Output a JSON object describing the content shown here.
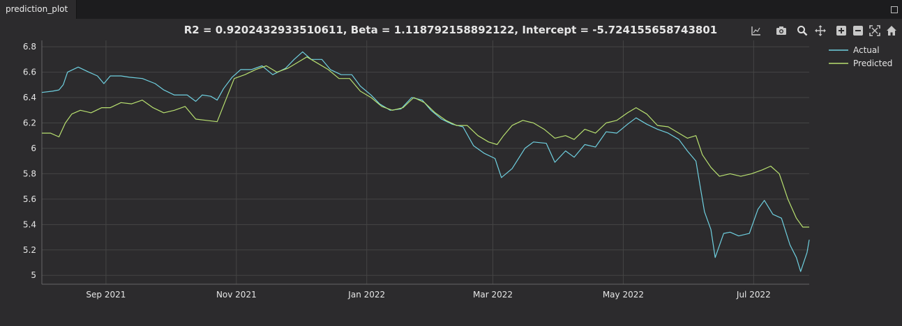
{
  "window": {
    "tab_label": "prediction_plot"
  },
  "toolbar": {
    "tools": [
      {
        "icon": "autoscale-icon"
      },
      {
        "icon": "camera-icon"
      },
      {
        "icon": "zoom-icon"
      },
      {
        "icon": "pan-icon"
      },
      {
        "icon": "zoom-in-icon"
      },
      {
        "icon": "zoom-out-icon"
      },
      {
        "icon": "reset-axes-icon"
      },
      {
        "icon": "home-icon"
      }
    ]
  },
  "colors": {
    "background": "#2c2b2d",
    "grid": "#454545",
    "actual": "#6fd0e0",
    "predicted": "#b8e070",
    "text": "#e6e6e6"
  },
  "chart_data": {
    "type": "line",
    "title": "R2 = 0.9202432933510611, Beta = 1.118792158892122, Intercept = -5.724155658743801",
    "xlabel": "",
    "ylabel": "",
    "xlim": [
      "2021-08-02",
      "2022-07-27"
    ],
    "ylim": [
      4.93,
      6.85
    ],
    "grid": true,
    "legend_position": "top-right",
    "x_ticks": [
      {
        "date": "2021-09-01",
        "label": "Sep 2021"
      },
      {
        "date": "2021-11-01",
        "label": "Nov 2021"
      },
      {
        "date": "2022-01-01",
        "label": "Jan 2022"
      },
      {
        "date": "2022-03-01",
        "label": "Mar 2022"
      },
      {
        "date": "2022-05-01",
        "label": "May 2022"
      },
      {
        "date": "2022-07-01",
        "label": "Jul 2022"
      }
    ],
    "y_ticks": [
      5,
      5.2,
      5.4,
      5.6,
      5.8,
      6,
      6.2,
      6.4,
      6.6,
      6.8
    ],
    "series": [
      {
        "name": "Actual",
        "points": [
          [
            "2021-08-02",
            6.44
          ],
          [
            "2021-08-07",
            6.45
          ],
          [
            "2021-08-10",
            6.46
          ],
          [
            "2021-08-12",
            6.5
          ],
          [
            "2021-08-14",
            6.6
          ],
          [
            "2021-08-19",
            6.64
          ],
          [
            "2021-08-24",
            6.6
          ],
          [
            "2021-08-28",
            6.57
          ],
          [
            "2021-08-31",
            6.51
          ],
          [
            "2021-09-03",
            6.57
          ],
          [
            "2021-09-08",
            6.57
          ],
          [
            "2021-09-12",
            6.56
          ],
          [
            "2021-09-18",
            6.55
          ],
          [
            "2021-09-24",
            6.51
          ],
          [
            "2021-09-28",
            6.46
          ],
          [
            "2021-10-03",
            6.42
          ],
          [
            "2021-10-09",
            6.42
          ],
          [
            "2021-10-13",
            6.37
          ],
          [
            "2021-10-16",
            6.42
          ],
          [
            "2021-10-20",
            6.41
          ],
          [
            "2021-10-23",
            6.38
          ],
          [
            "2021-10-26",
            6.47
          ],
          [
            "2021-10-30",
            6.56
          ],
          [
            "2021-11-03",
            6.62
          ],
          [
            "2021-11-08",
            6.62
          ],
          [
            "2021-11-13",
            6.65
          ],
          [
            "2021-11-18",
            6.58
          ],
          [
            "2021-11-24",
            6.63
          ],
          [
            "2021-11-28",
            6.7
          ],
          [
            "2021-12-02",
            6.76
          ],
          [
            "2021-12-06",
            6.7
          ],
          [
            "2021-12-11",
            6.7
          ],
          [
            "2021-12-15",
            6.62
          ],
          [
            "2021-12-20",
            6.58
          ],
          [
            "2021-12-25",
            6.58
          ],
          [
            "2021-12-29",
            6.49
          ],
          [
            "2022-01-03",
            6.42
          ],
          [
            "2022-01-07",
            6.35
          ],
          [
            "2022-01-12",
            6.3
          ],
          [
            "2022-01-17",
            6.31
          ],
          [
            "2022-01-22",
            6.4
          ],
          [
            "2022-01-27",
            6.38
          ],
          [
            "2022-01-31",
            6.3
          ],
          [
            "2022-02-05",
            6.23
          ],
          [
            "2022-02-10",
            6.19
          ],
          [
            "2022-02-15",
            6.17
          ],
          [
            "2022-02-20",
            6.02
          ],
          [
            "2022-02-25",
            5.96
          ],
          [
            "2022-03-02",
            5.92
          ],
          [
            "2022-03-05",
            5.77
          ],
          [
            "2022-03-10",
            5.84
          ],
          [
            "2022-03-16",
            6.0
          ],
          [
            "2022-03-20",
            6.05
          ],
          [
            "2022-03-26",
            6.04
          ],
          [
            "2022-03-30",
            5.89
          ],
          [
            "2022-04-04",
            5.98
          ],
          [
            "2022-04-08",
            5.93
          ],
          [
            "2022-04-13",
            6.03
          ],
          [
            "2022-04-18",
            6.01
          ],
          [
            "2022-04-23",
            6.13
          ],
          [
            "2022-04-28",
            6.12
          ],
          [
            "2022-05-03",
            6.19
          ],
          [
            "2022-05-07",
            6.24
          ],
          [
            "2022-05-12",
            6.19
          ],
          [
            "2022-05-17",
            6.15
          ],
          [
            "2022-05-22",
            6.12
          ],
          [
            "2022-05-27",
            6.07
          ],
          [
            "2022-05-31",
            5.98
          ],
          [
            "2022-06-04",
            5.9
          ],
          [
            "2022-06-06",
            5.7
          ],
          [
            "2022-06-08",
            5.5
          ],
          [
            "2022-06-11",
            5.36
          ],
          [
            "2022-06-13",
            5.14
          ],
          [
            "2022-06-17",
            5.33
          ],
          [
            "2022-06-20",
            5.34
          ],
          [
            "2022-06-24",
            5.31
          ],
          [
            "2022-06-29",
            5.33
          ],
          [
            "2022-07-03",
            5.52
          ],
          [
            "2022-07-06",
            5.59
          ],
          [
            "2022-07-10",
            5.48
          ],
          [
            "2022-07-14",
            5.45
          ],
          [
            "2022-07-18",
            5.24
          ],
          [
            "2022-07-21",
            5.14
          ],
          [
            "2022-07-23",
            5.03
          ],
          [
            "2022-07-26",
            5.18
          ],
          [
            "2022-07-27",
            5.28
          ]
        ]
      },
      {
        "name": "Predicted",
        "points": [
          [
            "2021-08-02",
            6.12
          ],
          [
            "2021-08-06",
            6.12
          ],
          [
            "2021-08-10",
            6.09
          ],
          [
            "2021-08-13",
            6.2
          ],
          [
            "2021-08-16",
            6.27
          ],
          [
            "2021-08-20",
            6.3
          ],
          [
            "2021-08-25",
            6.28
          ],
          [
            "2021-08-30",
            6.32
          ],
          [
            "2021-09-03",
            6.32
          ],
          [
            "2021-09-08",
            6.36
          ],
          [
            "2021-09-13",
            6.35
          ],
          [
            "2021-09-18",
            6.38
          ],
          [
            "2021-09-23",
            6.32
          ],
          [
            "2021-09-28",
            6.28
          ],
          [
            "2021-10-03",
            6.3
          ],
          [
            "2021-10-08",
            6.33
          ],
          [
            "2021-10-13",
            6.23
          ],
          [
            "2021-10-18",
            6.22
          ],
          [
            "2021-10-23",
            6.21
          ],
          [
            "2021-10-27",
            6.38
          ],
          [
            "2021-10-31",
            6.55
          ],
          [
            "2021-11-05",
            6.58
          ],
          [
            "2021-11-10",
            6.62
          ],
          [
            "2021-11-15",
            6.65
          ],
          [
            "2021-11-20",
            6.6
          ],
          [
            "2021-11-25",
            6.63
          ],
          [
            "2021-11-30",
            6.68
          ],
          [
            "2021-12-04",
            6.72
          ],
          [
            "2021-12-09",
            6.67
          ],
          [
            "2021-12-14",
            6.62
          ],
          [
            "2021-12-19",
            6.55
          ],
          [
            "2021-12-24",
            6.55
          ],
          [
            "2021-12-29",
            6.45
          ],
          [
            "2022-01-03",
            6.4
          ],
          [
            "2022-01-08",
            6.33
          ],
          [
            "2022-01-13",
            6.3
          ],
          [
            "2022-01-18",
            6.32
          ],
          [
            "2022-01-23",
            6.4
          ],
          [
            "2022-01-28",
            6.36
          ],
          [
            "2022-02-02",
            6.28
          ],
          [
            "2022-02-07",
            6.22
          ],
          [
            "2022-02-12",
            6.18
          ],
          [
            "2022-02-17",
            6.18
          ],
          [
            "2022-02-22",
            6.1
          ],
          [
            "2022-02-27",
            6.05
          ],
          [
            "2022-03-03",
            6.03
          ],
          [
            "2022-03-06",
            6.1
          ],
          [
            "2022-03-10",
            6.18
          ],
          [
            "2022-03-15",
            6.22
          ],
          [
            "2022-03-20",
            6.2
          ],
          [
            "2022-03-25",
            6.15
          ],
          [
            "2022-03-30",
            6.08
          ],
          [
            "2022-04-04",
            6.1
          ],
          [
            "2022-04-08",
            6.07
          ],
          [
            "2022-04-13",
            6.15
          ],
          [
            "2022-04-18",
            6.12
          ],
          [
            "2022-04-23",
            6.2
          ],
          [
            "2022-04-28",
            6.22
          ],
          [
            "2022-05-03",
            6.28
          ],
          [
            "2022-05-07",
            6.32
          ],
          [
            "2022-05-12",
            6.27
          ],
          [
            "2022-05-17",
            6.18
          ],
          [
            "2022-05-22",
            6.17
          ],
          [
            "2022-05-27",
            6.12
          ],
          [
            "2022-05-31",
            6.08
          ],
          [
            "2022-06-04",
            6.1
          ],
          [
            "2022-06-07",
            5.95
          ],
          [
            "2022-06-11",
            5.85
          ],
          [
            "2022-06-15",
            5.78
          ],
          [
            "2022-06-20",
            5.8
          ],
          [
            "2022-06-25",
            5.78
          ],
          [
            "2022-06-30",
            5.8
          ],
          [
            "2022-07-05",
            5.83
          ],
          [
            "2022-07-09",
            5.86
          ],
          [
            "2022-07-13",
            5.8
          ],
          [
            "2022-07-17",
            5.6
          ],
          [
            "2022-07-21",
            5.45
          ],
          [
            "2022-07-24",
            5.38
          ],
          [
            "2022-07-27",
            5.38
          ]
        ]
      }
    ]
  }
}
